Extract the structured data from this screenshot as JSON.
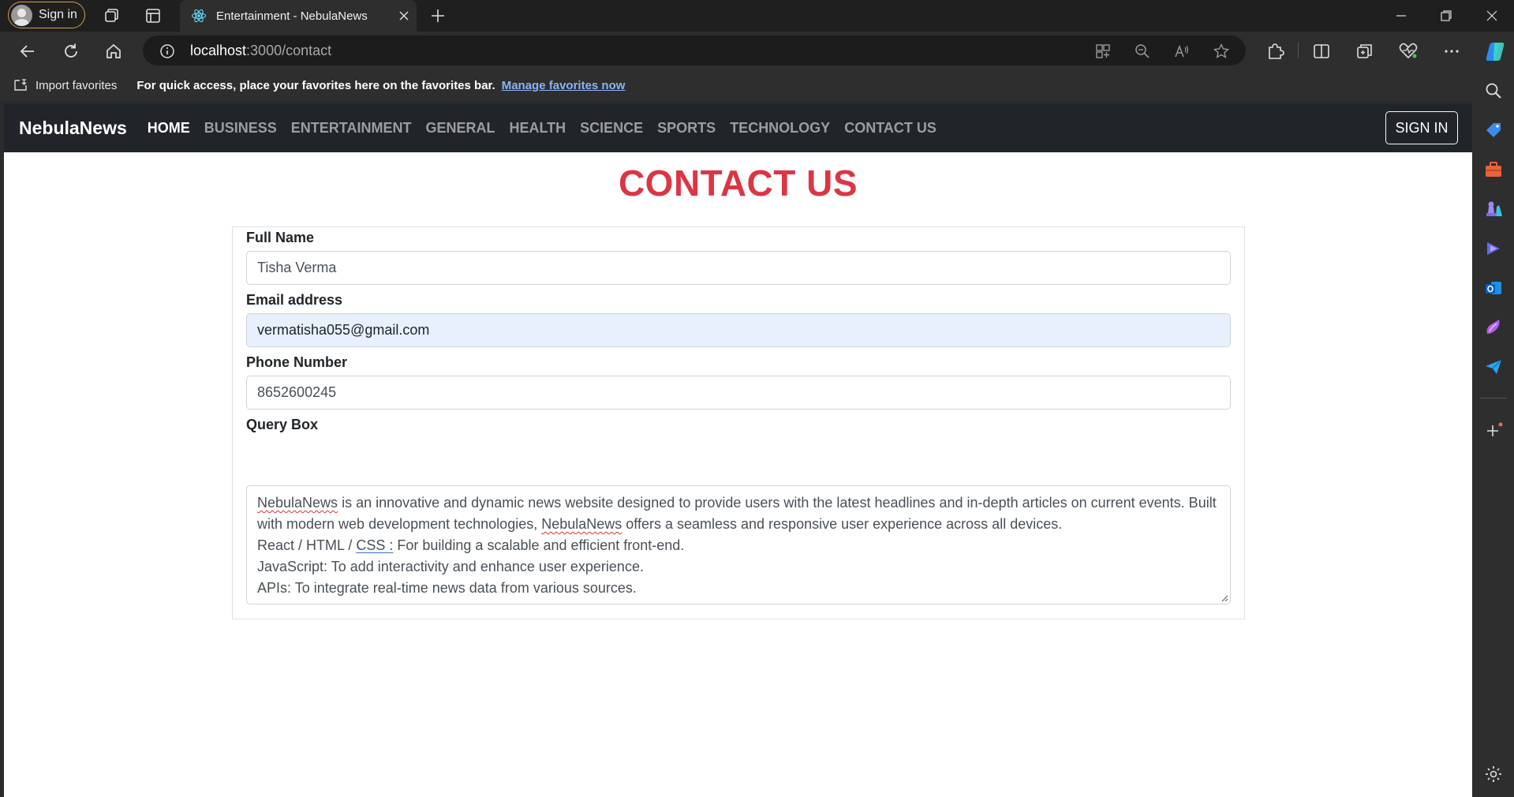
{
  "browser": {
    "signin_label": "Sign in",
    "tab_title": "Entertainment - NebulaNews",
    "url_host": "localhost",
    "url_rest": ":3000/contact",
    "favorites": {
      "import_label": "Import favorites",
      "message": "For quick access, place your favorites here on the favorites bar.",
      "link": "Manage favorites now"
    }
  },
  "site": {
    "brand": "NebulaNews",
    "nav": [
      {
        "label": "HOME",
        "active": true
      },
      {
        "label": "BUSINESS"
      },
      {
        "label": "ENTERTAINMENT"
      },
      {
        "label": "GENERAL"
      },
      {
        "label": "HEALTH"
      },
      {
        "label": "SCIENCE"
      },
      {
        "label": "SPORTS"
      },
      {
        "label": "TECHNOLOGY"
      },
      {
        "label": "CONTACT US"
      }
    ],
    "signin_button": "SIGN IN"
  },
  "page": {
    "title": "CONTACT US",
    "form": {
      "full_name": {
        "label": "Full Name",
        "value": "Tisha Verma"
      },
      "email": {
        "label": "Email address",
        "value": "vermatisha055@gmail.com"
      },
      "phone": {
        "label": "Phone Number",
        "value": "8652600245"
      },
      "query": {
        "label": "Query Box",
        "line1_word1": "NebulaNews",
        "line1_rest": " is an innovative and dynamic news website designed to provide users with the latest headlines and in-depth articles on current events. Built",
        "line2_pre": "with modern web development technologies, ",
        "line2_word": "NebulaNews",
        "line2_post": " offers a seamless and responsive user experience across all devices.",
        "line3_pre": "React / HTML / ",
        "line3_word": "CSS :",
        "line3_post": " For building a scalable and efficient front-end.",
        "line4": "JavaScript: To add interactivity and enhance user experience.",
        "line5": "APIs: To integrate real-time news data from various sources."
      }
    }
  },
  "colors": {
    "accent_title": "#dc3545",
    "navbar_bg": "#212529",
    "autofill_bg": "#e8f0fe",
    "signin_border": "#d99a4e"
  }
}
